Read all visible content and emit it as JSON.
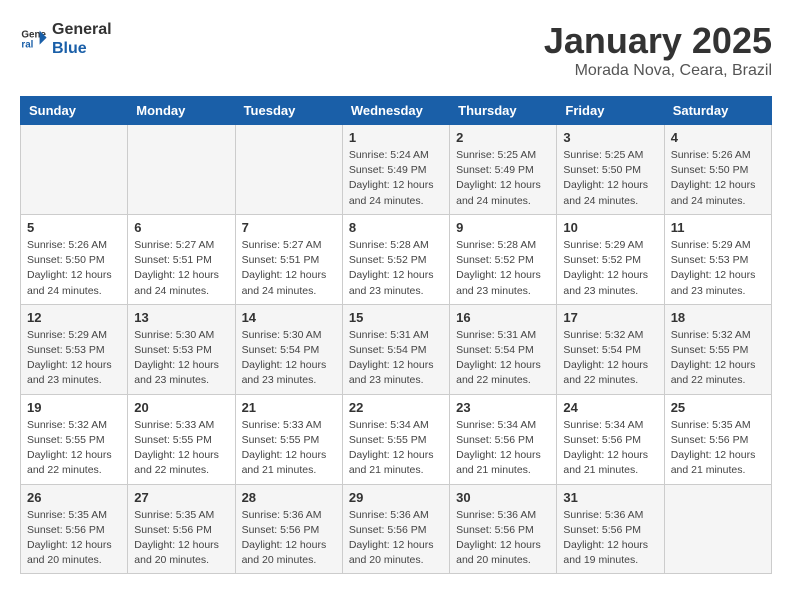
{
  "logo": {
    "line1": "General",
    "line2": "Blue"
  },
  "title": "January 2025",
  "subtitle": "Morada Nova, Ceara, Brazil",
  "days_of_week": [
    "Sunday",
    "Monday",
    "Tuesday",
    "Wednesday",
    "Thursday",
    "Friday",
    "Saturday"
  ],
  "weeks": [
    [
      {
        "day": "",
        "info": ""
      },
      {
        "day": "",
        "info": ""
      },
      {
        "day": "",
        "info": ""
      },
      {
        "day": "1",
        "info": "Sunrise: 5:24 AM\nSunset: 5:49 PM\nDaylight: 12 hours\nand 24 minutes."
      },
      {
        "day": "2",
        "info": "Sunrise: 5:25 AM\nSunset: 5:49 PM\nDaylight: 12 hours\nand 24 minutes."
      },
      {
        "day": "3",
        "info": "Sunrise: 5:25 AM\nSunset: 5:50 PM\nDaylight: 12 hours\nand 24 minutes."
      },
      {
        "day": "4",
        "info": "Sunrise: 5:26 AM\nSunset: 5:50 PM\nDaylight: 12 hours\nand 24 minutes."
      }
    ],
    [
      {
        "day": "5",
        "info": "Sunrise: 5:26 AM\nSunset: 5:50 PM\nDaylight: 12 hours\nand 24 minutes."
      },
      {
        "day": "6",
        "info": "Sunrise: 5:27 AM\nSunset: 5:51 PM\nDaylight: 12 hours\nand 24 minutes."
      },
      {
        "day": "7",
        "info": "Sunrise: 5:27 AM\nSunset: 5:51 PM\nDaylight: 12 hours\nand 24 minutes."
      },
      {
        "day": "8",
        "info": "Sunrise: 5:28 AM\nSunset: 5:52 PM\nDaylight: 12 hours\nand 23 minutes."
      },
      {
        "day": "9",
        "info": "Sunrise: 5:28 AM\nSunset: 5:52 PM\nDaylight: 12 hours\nand 23 minutes."
      },
      {
        "day": "10",
        "info": "Sunrise: 5:29 AM\nSunset: 5:52 PM\nDaylight: 12 hours\nand 23 minutes."
      },
      {
        "day": "11",
        "info": "Sunrise: 5:29 AM\nSunset: 5:53 PM\nDaylight: 12 hours\nand 23 minutes."
      }
    ],
    [
      {
        "day": "12",
        "info": "Sunrise: 5:29 AM\nSunset: 5:53 PM\nDaylight: 12 hours\nand 23 minutes."
      },
      {
        "day": "13",
        "info": "Sunrise: 5:30 AM\nSunset: 5:53 PM\nDaylight: 12 hours\nand 23 minutes."
      },
      {
        "day": "14",
        "info": "Sunrise: 5:30 AM\nSunset: 5:54 PM\nDaylight: 12 hours\nand 23 minutes."
      },
      {
        "day": "15",
        "info": "Sunrise: 5:31 AM\nSunset: 5:54 PM\nDaylight: 12 hours\nand 23 minutes."
      },
      {
        "day": "16",
        "info": "Sunrise: 5:31 AM\nSunset: 5:54 PM\nDaylight: 12 hours\nand 22 minutes."
      },
      {
        "day": "17",
        "info": "Sunrise: 5:32 AM\nSunset: 5:54 PM\nDaylight: 12 hours\nand 22 minutes."
      },
      {
        "day": "18",
        "info": "Sunrise: 5:32 AM\nSunset: 5:55 PM\nDaylight: 12 hours\nand 22 minutes."
      }
    ],
    [
      {
        "day": "19",
        "info": "Sunrise: 5:32 AM\nSunset: 5:55 PM\nDaylight: 12 hours\nand 22 minutes."
      },
      {
        "day": "20",
        "info": "Sunrise: 5:33 AM\nSunset: 5:55 PM\nDaylight: 12 hours\nand 22 minutes."
      },
      {
        "day": "21",
        "info": "Sunrise: 5:33 AM\nSunset: 5:55 PM\nDaylight: 12 hours\nand 21 minutes."
      },
      {
        "day": "22",
        "info": "Sunrise: 5:34 AM\nSunset: 5:55 PM\nDaylight: 12 hours\nand 21 minutes."
      },
      {
        "day": "23",
        "info": "Sunrise: 5:34 AM\nSunset: 5:56 PM\nDaylight: 12 hours\nand 21 minutes."
      },
      {
        "day": "24",
        "info": "Sunrise: 5:34 AM\nSunset: 5:56 PM\nDaylight: 12 hours\nand 21 minutes."
      },
      {
        "day": "25",
        "info": "Sunrise: 5:35 AM\nSunset: 5:56 PM\nDaylight: 12 hours\nand 21 minutes."
      }
    ],
    [
      {
        "day": "26",
        "info": "Sunrise: 5:35 AM\nSunset: 5:56 PM\nDaylight: 12 hours\nand 20 minutes."
      },
      {
        "day": "27",
        "info": "Sunrise: 5:35 AM\nSunset: 5:56 PM\nDaylight: 12 hours\nand 20 minutes."
      },
      {
        "day": "28",
        "info": "Sunrise: 5:36 AM\nSunset: 5:56 PM\nDaylight: 12 hours\nand 20 minutes."
      },
      {
        "day": "29",
        "info": "Sunrise: 5:36 AM\nSunset: 5:56 PM\nDaylight: 12 hours\nand 20 minutes."
      },
      {
        "day": "30",
        "info": "Sunrise: 5:36 AM\nSunset: 5:56 PM\nDaylight: 12 hours\nand 20 minutes."
      },
      {
        "day": "31",
        "info": "Sunrise: 5:36 AM\nSunset: 5:56 PM\nDaylight: 12 hours\nand 19 minutes."
      },
      {
        "day": "",
        "info": ""
      }
    ]
  ]
}
